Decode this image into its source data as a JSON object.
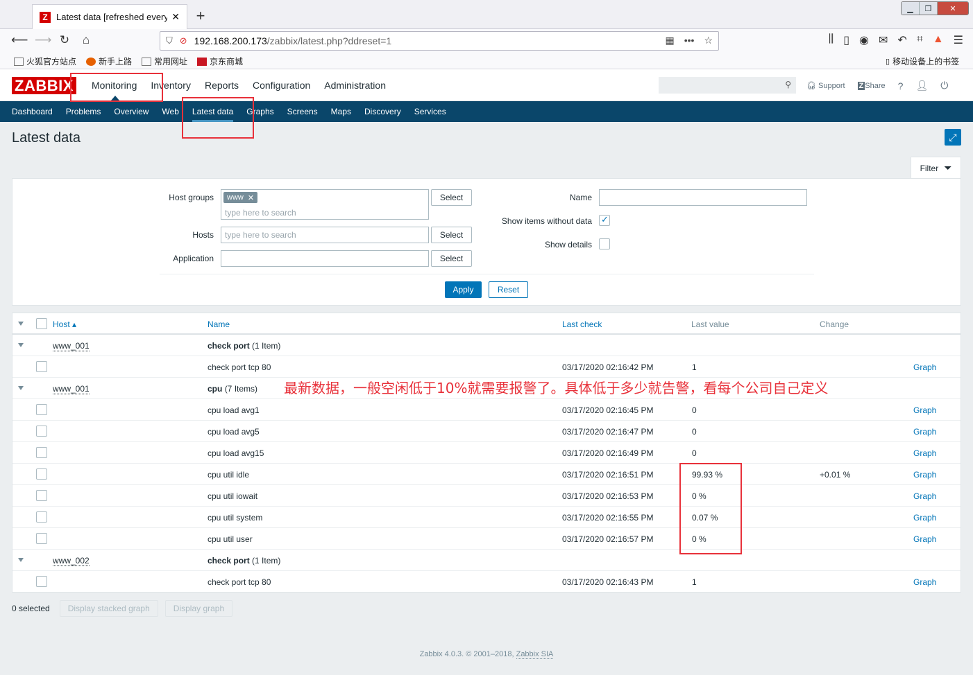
{
  "browser": {
    "tab_title": "Latest data [refreshed every",
    "tab_favicon": "Z",
    "url_host": "192.168.200.173",
    "url_rest": "/zabbix/latest.php?ddreset=1",
    "bookmarks": [
      "火狐官方站点",
      "新手上路",
      "常用网址",
      "京东商城"
    ],
    "mobile_bookmarks": "移动设备上的书签"
  },
  "header": {
    "logo": "ZABBIX",
    "menu": [
      "Monitoring",
      "Inventory",
      "Reports",
      "Configuration",
      "Administration"
    ],
    "support": "Support",
    "share": "Share",
    "help": "?"
  },
  "subnav": [
    "Dashboard",
    "Problems",
    "Overview",
    "Web",
    "Latest data",
    "Graphs",
    "Screens",
    "Maps",
    "Discovery",
    "Services"
  ],
  "page": {
    "title": "Latest data"
  },
  "filter": {
    "tab_label": "Filter",
    "host_groups_label": "Host groups",
    "host_groups_chip": "www",
    "host_groups_placeholder": "type here to search",
    "hosts_label": "Hosts",
    "hosts_placeholder": "type here to search",
    "application_label": "Application",
    "select_label": "Select",
    "name_label": "Name",
    "show_without_data_label": "Show items without data",
    "show_details_label": "Show details",
    "apply_label": "Apply",
    "reset_label": "Reset"
  },
  "table": {
    "headers": {
      "host": "Host ▴",
      "name": "Name",
      "last_check": "Last check",
      "last_value": "Last value",
      "change": "Change"
    },
    "groups": [
      {
        "host": "www_001",
        "app": "check port",
        "count": "(1 Item)"
      },
      {
        "host": "www_001",
        "app": "cpu",
        "count": "(7 Items)"
      },
      {
        "host": "www_002",
        "app": "check port",
        "count": "(1 Item)"
      }
    ],
    "rows": [
      {
        "name": "check port tcp 80",
        "last_check": "03/17/2020 02:16:42 PM",
        "last_value": "1",
        "change": "",
        "link": "Graph"
      },
      {
        "name": "cpu load avg1",
        "last_check": "03/17/2020 02:16:45 PM",
        "last_value": "0",
        "change": "",
        "link": "Graph"
      },
      {
        "name": "cpu load avg5",
        "last_check": "03/17/2020 02:16:47 PM",
        "last_value": "0",
        "change": "",
        "link": "Graph"
      },
      {
        "name": "cpu load avg15",
        "last_check": "03/17/2020 02:16:49 PM",
        "last_value": "0",
        "change": "",
        "link": "Graph"
      },
      {
        "name": "cpu util idle",
        "last_check": "03/17/2020 02:16:51 PM",
        "last_value": "99.93 %",
        "change": "+0.01 %",
        "link": "Graph"
      },
      {
        "name": "cpu util iowait",
        "last_check": "03/17/2020 02:16:53 PM",
        "last_value": "0 %",
        "change": "",
        "link": "Graph"
      },
      {
        "name": "cpu util system",
        "last_check": "03/17/2020 02:16:55 PM",
        "last_value": "0.07 %",
        "change": "",
        "link": "Graph"
      },
      {
        "name": "cpu util user",
        "last_check": "03/17/2020 02:16:57 PM",
        "last_value": "0 %",
        "change": "",
        "link": "Graph"
      },
      {
        "name": "check port tcp 80",
        "last_check": "03/17/2020 02:16:43 PM",
        "last_value": "1",
        "change": "",
        "link": "Graph"
      }
    ]
  },
  "footer": {
    "selected": "0 selected",
    "stacked_label": "Display stacked graph",
    "graph_label": "Display graph",
    "copyright": "Zabbix 4.0.3. © 2001–2018,",
    "company": "Zabbix SIA"
  },
  "annotation": "最新数据，一般空闲低于10%就需要报警了。具体低于多少就告警，看每个公司自己定义",
  "colors": {
    "brand_red": "#d40000",
    "nav_blue": "#0a466a",
    "link_blue": "#0275b8",
    "annotation_red": "#e8313a"
  }
}
